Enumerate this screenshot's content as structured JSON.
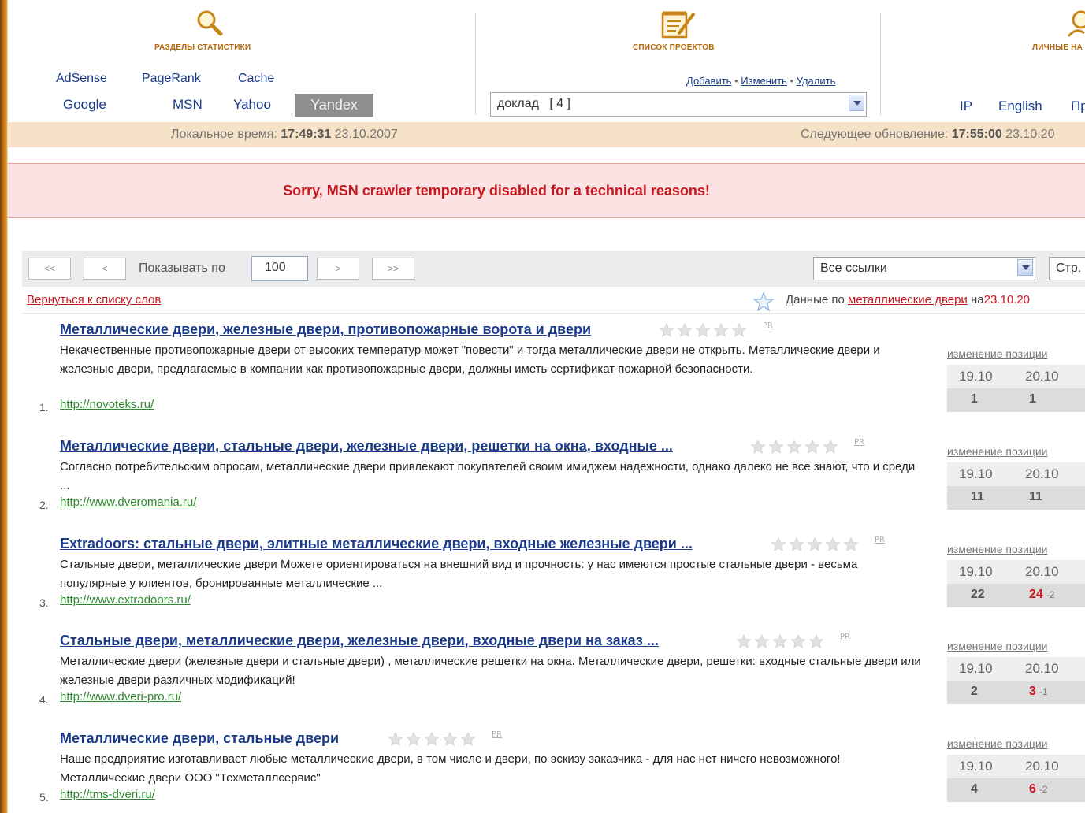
{
  "header": {
    "stats_title": "РАЗДЕЛЫ СТАТИСТИКИ",
    "projects_title": "СПИСОК ПРОЕКТОВ",
    "personal_title": "ЛИЧНЫЕ НА",
    "stats_links": {
      "adsense": "AdSense",
      "pagerank": "PageRank",
      "cache": "Cache",
      "google": "Google",
      "msn": "MSN",
      "yahoo": "Yahoo",
      "yandex": "Yandex"
    },
    "project_actions": {
      "add": "Добавить",
      "edit": "Изменить",
      "delete": "Удалить",
      "sep": "•"
    },
    "project_select": "доклад   [ 4 ]",
    "personal_links": {
      "ip": "IP",
      "english": "English",
      "pr": "Пр"
    }
  },
  "timebar": {
    "local_label": "Локальное время:",
    "local_time": "17:49:31",
    "local_date": "23.10.2007",
    "next_label": "Следующее обновление:",
    "next_time": "17:55:00",
    "next_date": "23.10.20"
  },
  "alert": "Sorry, MSN crawler temporary disabled for a technical reasons!",
  "pager": {
    "first": "<<",
    "prev": "<",
    "show_label": "Показывать по",
    "per_page": "100",
    "next": ">",
    "last": ">>",
    "filter_select": "Все ссылки",
    "page_label": "Стр."
  },
  "back_link": "Вернуться к списку слов",
  "data_for": {
    "prefix": "Данные по",
    "keyword": "металлические двери",
    "on": "на",
    "date": "23.10.20"
  },
  "position_header": "изменение позиции",
  "results": [
    {
      "num": "1.",
      "title": "Металлические двери, железные двери, противопожарные ворота и двери",
      "desc": "Некачественные противопожарные двери от высоких температур может \"повести\" и тогда металлические двери не открыть. Металлические двери и железные двери, предлагаемые в компании как противопожарные двери, должны иметь сертификат пожарной безопасности.",
      "url": "http://novoteks.ru/",
      "pr": "PR",
      "d1": "19.10",
      "d2": "20.10",
      "v1": "1",
      "v2": "1",
      "delta": ""
    },
    {
      "num": "2.",
      "title": "Металлические двери, стальные двери, железные двери, решетки на окна, входные ...",
      "desc": "Согласно потребительским опросам, металлические двери привлекают покупателей своим имиджем надежности, однако далеко не все знают, что и среди ...",
      "url": "http://www.dveromania.ru/",
      "pr": "PR",
      "d1": "19.10",
      "d2": "20.10",
      "v1": "11",
      "v2": "11",
      "delta": ""
    },
    {
      "num": "3.",
      "title": "Extradoors: стальные двери, элитные металлические двери, входные железные двери ...",
      "desc": "Стальные двери, металлические двери Можете ориентироваться на внешний вид и прочность: у нас имеются простые стальные двери - весьма популярные у клиентов, бронированные металлические ...",
      "url": "http://www.extradoors.ru/",
      "pr": "PR",
      "d1": "19.10",
      "d2": "20.10",
      "v1": "22",
      "v2": "24",
      "delta": "-2"
    },
    {
      "num": "4.",
      "title": "Стальные двери, металлические двери, железные двери, входные двери на заказ ...",
      "desc": "Металлические двери (железные двери и стальные двери) , металлические решетки на окна. Металлические двери, решетки: входные стальные двери или железные двери различных модификаций!",
      "url": "http://www.dveri-pro.ru/",
      "pr": "PR",
      "d1": "19.10",
      "d2": "20.10",
      "v1": "2",
      "v2": "3",
      "delta": "-1"
    },
    {
      "num": "5.",
      "title": "Металлические двери, стальные двери",
      "desc": "Наше предприятие изготавливает любые металлические двери, в том числе и двери, по эскизу заказчика - для нас нет ничего невозможного! Металлические двери ООО \"Техметаллсервис\"",
      "url": "http://tms-dveri.ru/",
      "pr": "PR",
      "d1": "19.10",
      "d2": "20.10",
      "v1": "4",
      "v2": "6",
      "delta": "-2"
    }
  ],
  "colors": {
    "link": "#1a3b8a",
    "accent_red": "#c8161e",
    "url_green": "#2e8a2e",
    "section_orange": "#b5690d",
    "time_bar": "#f6e2c7",
    "alert_bg": "#fbe3e3"
  }
}
